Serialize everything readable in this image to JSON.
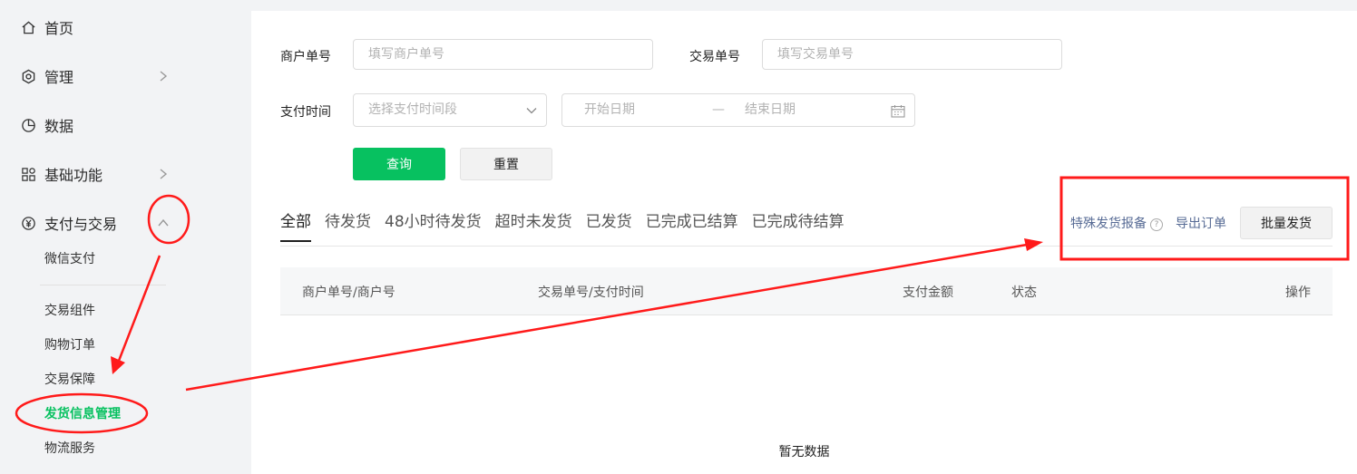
{
  "sidebar": {
    "items": [
      {
        "label": "首页",
        "icon": "home-icon"
      },
      {
        "label": "管理",
        "icon": "settings-icon"
      },
      {
        "label": "数据",
        "icon": "pie-chart-icon"
      },
      {
        "label": "基础功能",
        "icon": "grid-icon"
      },
      {
        "label": "支付与交易",
        "icon": "yuan-icon"
      }
    ],
    "sub_items": [
      {
        "label": "微信支付"
      },
      {
        "label": "交易组件"
      },
      {
        "label": "购物订单"
      },
      {
        "label": "交易保障"
      },
      {
        "label": "发货信息管理",
        "active": true
      },
      {
        "label": "物流服务"
      }
    ]
  },
  "filters": {
    "merchant_no_label": "商户单号",
    "merchant_no_placeholder": "填写商户单号",
    "trade_no_label": "交易单号",
    "trade_no_placeholder": "填写交易单号",
    "pay_time_label": "支付时间",
    "pay_time_select": "选择支付时间段",
    "start_date": "开始日期",
    "date_separator": "—",
    "end_date": "结束日期",
    "query_button": "查询",
    "reset_button": "重置"
  },
  "tabs": [
    "全部",
    "待发货",
    "48小时待发货",
    "超时未发货",
    "已发货",
    "已完成已结算",
    "已完成待结算"
  ],
  "actions": {
    "special_report": "特殊发货报备",
    "export_orders": "导出订单",
    "batch_ship": "批量发货"
  },
  "table": {
    "columns": [
      "商户单号/商户号",
      "交易单号/支付时间",
      "支付金额",
      "状态",
      "操作"
    ],
    "empty_text": "暂无数据"
  },
  "colors": {
    "accent": "#07c160",
    "link": "#576b95",
    "annotation": "#ff1a1a"
  }
}
